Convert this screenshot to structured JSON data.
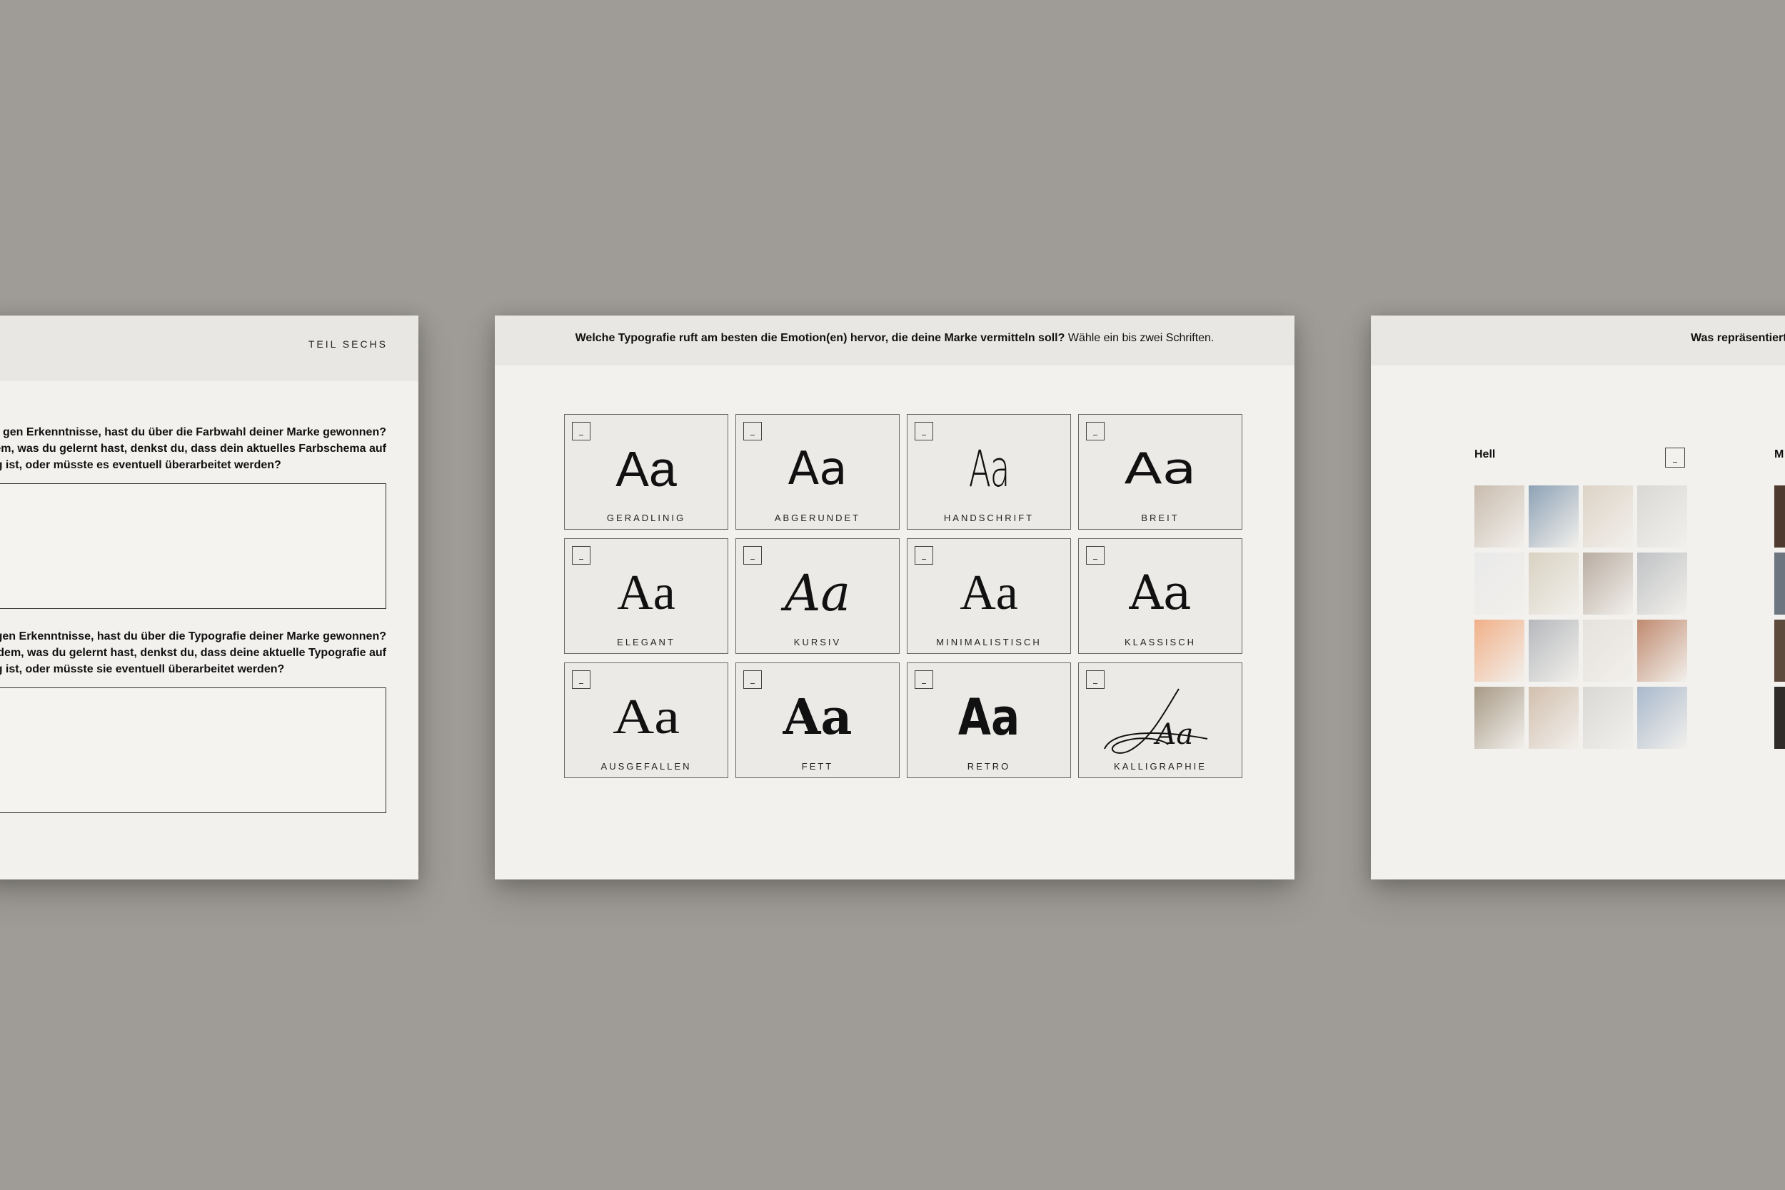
{
  "left_page": {
    "section_label": "TEIL SECHS",
    "question1_lines": [
      "gen Erkenntnisse, hast du über die Farbwahl deiner Marke gewonnen?",
      "dem, was du gelernt hast, denkst du, dass dein aktuelles Farbschema auf",
      "Weg ist, oder müsste es eventuell überarbeitet werden?"
    ],
    "question2_lines": [
      "gen Erkenntnisse, hast du über die Typografie deiner Marke gewonnen?",
      "dem, was du gelernt hast, denkst du, dass deine aktuelle Typografie auf",
      "Weg ist, oder müsste sie eventuell überarbeitet werden?"
    ]
  },
  "center_page": {
    "question_bold": "Welche Typografie ruft am besten die Emotion(en) hervor, die deine Marke vermitteln soll?",
    "instruction": "Wähle ein bis zwei Schriften.",
    "samples": [
      {
        "glyphs": "Aa",
        "label": "GERADLINIG",
        "icon": "checkbox"
      },
      {
        "glyphs": "Aa",
        "label": "ABGERUNDET",
        "icon": "checkbox"
      },
      {
        "glyphs": "Aa",
        "label": "HANDSCHRIFT",
        "icon": "checkbox"
      },
      {
        "glyphs": "Aa",
        "label": "BREIT",
        "icon": "checkbox"
      },
      {
        "glyphs": "Aa",
        "label": "ELEGANT",
        "icon": "checkbox"
      },
      {
        "glyphs": "Aa",
        "label": "KURSIV",
        "icon": "checkbox"
      },
      {
        "glyphs": "Aa",
        "label": "MINIMALISTISCH",
        "icon": "checkbox"
      },
      {
        "glyphs": "Aa",
        "label": "KLASSISCH",
        "icon": "checkbox"
      },
      {
        "glyphs": "Aa",
        "label": "AUSGEFALLEN",
        "icon": "checkbox"
      },
      {
        "glyphs": "Aa",
        "label": "FETT",
        "icon": "checkbox"
      },
      {
        "glyphs": "Aa",
        "label": "RETRO",
        "icon": "checkbox"
      },
      {
        "glyphs": "Aa",
        "label": "KALLIGRAPHIE",
        "icon": "checkbox"
      }
    ]
  },
  "right_page": {
    "question_bold": "Was repräsentiert",
    "option1_label": "Hell",
    "option2_label": "M",
    "photo_colors": [
      "#c9bcae",
      "#8ea2b6",
      "#ddd3c6",
      "#d9d8d4",
      "#e9e9e9",
      "#d8d2c2",
      "#b9aca1",
      "#bfc2c4",
      "#f1b088",
      "#b5b8bc",
      "#e5e1dc",
      "#c08a6f",
      "#a89a86",
      "#d2bfae",
      "#d9d8d5",
      "#a9b9cc"
    ],
    "photo_colors_2": [
      "#4e3a2e",
      "#6c7580",
      "#5d4a3c",
      "#2e2b29"
    ]
  }
}
